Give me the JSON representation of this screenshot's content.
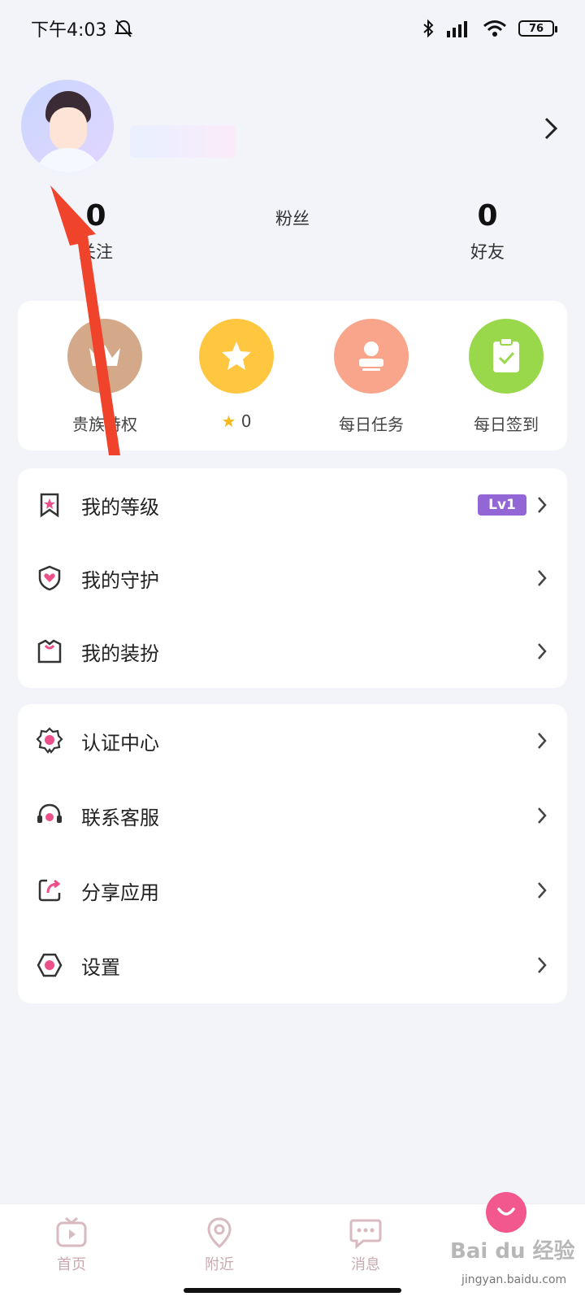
{
  "status_bar": {
    "time": "下午4:03",
    "battery": "76"
  },
  "profile": {
    "avatar_icon": "avatar-icon"
  },
  "stats": [
    {
      "value": "0",
      "label": "关注"
    },
    {
      "value": "",
      "label": "粉丝"
    },
    {
      "value": "0",
      "label": "好友"
    }
  ],
  "actions": [
    {
      "label": "贵族特权",
      "icon": "crown-icon",
      "color": "#d3a98a"
    },
    {
      "label": "0",
      "icon": "star-icon",
      "color": "#ffc640"
    },
    {
      "label": "每日任务",
      "icon": "stamp-icon",
      "color": "#f8a58b"
    },
    {
      "label": "每日签到",
      "icon": "clipboard-check-icon",
      "color": "#9ad84b"
    }
  ],
  "list1": [
    {
      "label": "我的等级",
      "icon": "bookmark-star-icon",
      "badge": "Lv1"
    },
    {
      "label": "我的守护",
      "icon": "shield-heart-icon"
    },
    {
      "label": "我的装扮",
      "icon": "shirt-icon"
    }
  ],
  "list2": [
    {
      "label": "认证中心",
      "icon": "badge-icon"
    },
    {
      "label": "联系客服",
      "icon": "headset-icon"
    },
    {
      "label": "分享应用",
      "icon": "share-icon"
    },
    {
      "label": "设置",
      "icon": "gear-icon"
    }
  ],
  "tabs": [
    {
      "label": "首页",
      "icon": "tv-icon"
    },
    {
      "label": "附近",
      "icon": "location-pin-icon"
    },
    {
      "label": "消息",
      "icon": "chat-bubble-icon"
    }
  ],
  "watermark": {
    "main": "Bai du 经验",
    "sub": "jingyan.baidu.com"
  },
  "colors": {
    "accent": "#f2578d",
    "badge": "#9366d6",
    "annotation_arrow": "#f0432c"
  }
}
